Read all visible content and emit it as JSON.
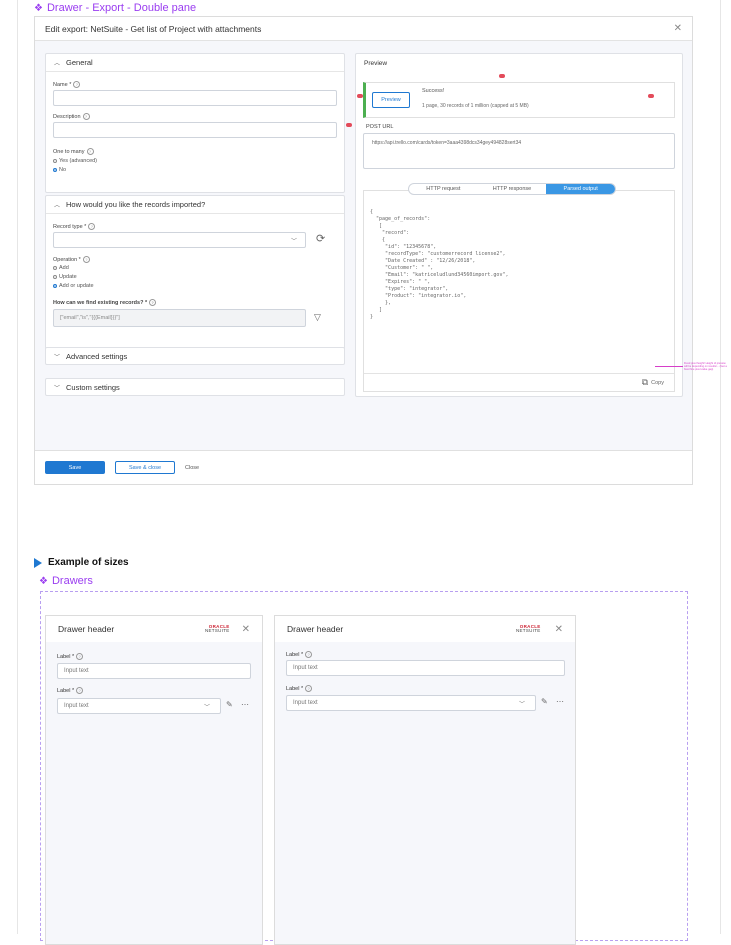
{
  "frame1": {
    "title": "Drawer - Export - Double pane"
  },
  "drawer": {
    "title": "Edit export: NetSuite - Get list of Project with attachments",
    "general": {
      "heading": "General",
      "name_label": "Name *",
      "description_label": "Description",
      "one_to_many_label": "One to many",
      "options": [
        "Yes (advanced)",
        "No"
      ],
      "selected": "No"
    },
    "imported": {
      "heading": "How would you like the records imported?",
      "record_type_label": "Record type *",
      "operation_label": "Operation *",
      "operations": [
        "Add",
        "Update",
        "Add or update"
      ],
      "selected": "Add or update",
      "find_label": "How can we find existing records? *",
      "find_value": "[\"email\",\"is\",\"{{{Email}}}\"]"
    },
    "advanced_label": "Advanced settings",
    "custom_label": "Custom settings",
    "footer": {
      "save": "Save",
      "save_close": "Save & close",
      "close": "Close"
    },
    "preview": {
      "heading": "Preview",
      "button": "Preview",
      "status": "Success!",
      "summary": "1 page, 30 records of 1 million (capped at 5 MB)",
      "post_url_label": "POST URL",
      "post_url": "https://api.trello.com/cards/token=3aaa4398dcs34gey494828sert34",
      "tabs": [
        "HTTP request",
        "HTTP response",
        "Parsed output"
      ],
      "active_tab": "Parsed output",
      "code_lines": [
        "{",
        "  \"page_of_records\":",
        "   [",
        "    \"record\":",
        "    {",
        "     \"id\": \"12345678\",",
        "     \"recordType\": \"customerrecord license2\",",
        "     \"Date Created\" : \"12/26/2018\",",
        "     \"Customer\": \" \",",
        "     \"Email\": \"katriceludlund34560import.gov\",",
        "     \"Expires\": \" \",",
        "     \"type\": \"integrator\",",
        "     \"Product\": \"integrator.io\",",
        "     },",
        "   ]",
        "}"
      ],
      "copy": "Copy"
    }
  },
  "annotation": "Fixed pixel height! Height of preview will be depending on results/... (Get a fixed fine pixel value gap)",
  "sizes": {
    "title": "Example of sizes"
  },
  "frame2": {
    "title": "Drawers"
  },
  "mini_drawers": [
    {
      "header": "Drawer header",
      "logo_line1": "ORACLE",
      "logo_line2": "NETSUITE",
      "label1": "Label *",
      "input1": "Input text",
      "label2": "Label *",
      "input2": "Input text"
    },
    {
      "header": "Drawer header",
      "logo_line1": "ORACLE",
      "logo_line2": "NETSUITE",
      "label1": "Label *",
      "input1": "Input text",
      "label2": "Label *",
      "input2": "Input text"
    }
  ],
  "colors": {
    "accent": "#1f78d1",
    "frame_title": "#9a3df0",
    "success": "#4caf50",
    "error_badge": "#e34b5a",
    "annotation": "#d63ec9"
  }
}
